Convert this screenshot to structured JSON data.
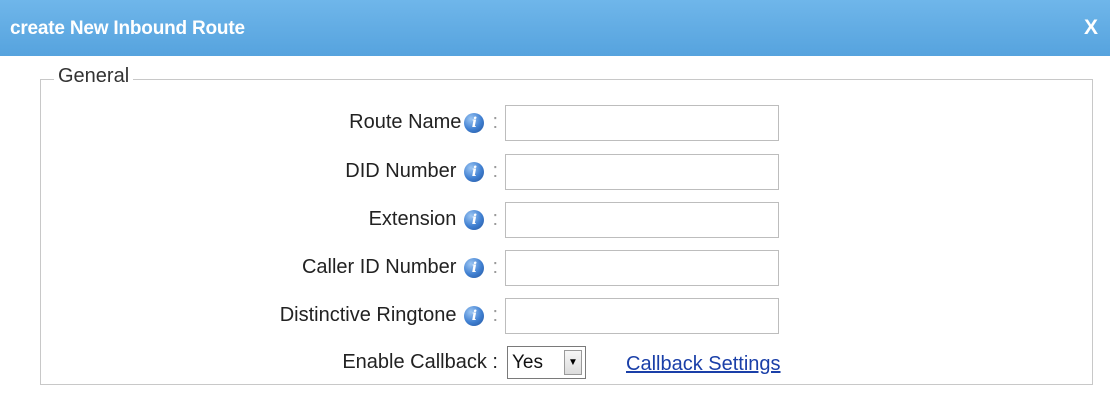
{
  "dialog": {
    "title": "create New Inbound Route",
    "close_label": "X"
  },
  "general": {
    "legend": "General",
    "fields": [
      {
        "label": "Route Name",
        "value": ""
      },
      {
        "label": "DID Number",
        "value": ""
      },
      {
        "label": "Extension",
        "value": ""
      },
      {
        "label": "Caller ID Number",
        "value": ""
      },
      {
        "label": "Distinctive Ringtone",
        "value": ""
      }
    ],
    "colon": ":",
    "info_icon": "i",
    "enable_callback": {
      "label": "Enable Callback :",
      "selected": "Yes",
      "arrow": "▼",
      "link": "Callback Settings"
    }
  },
  "icons": {
    "info": "info-icon",
    "close": "close-icon",
    "dropdown": "chevron-down-icon"
  },
  "colors": {
    "titlebar": "#5aa7e0",
    "link": "#1a3fa8",
    "info_icon": "#3f7fd1"
  }
}
